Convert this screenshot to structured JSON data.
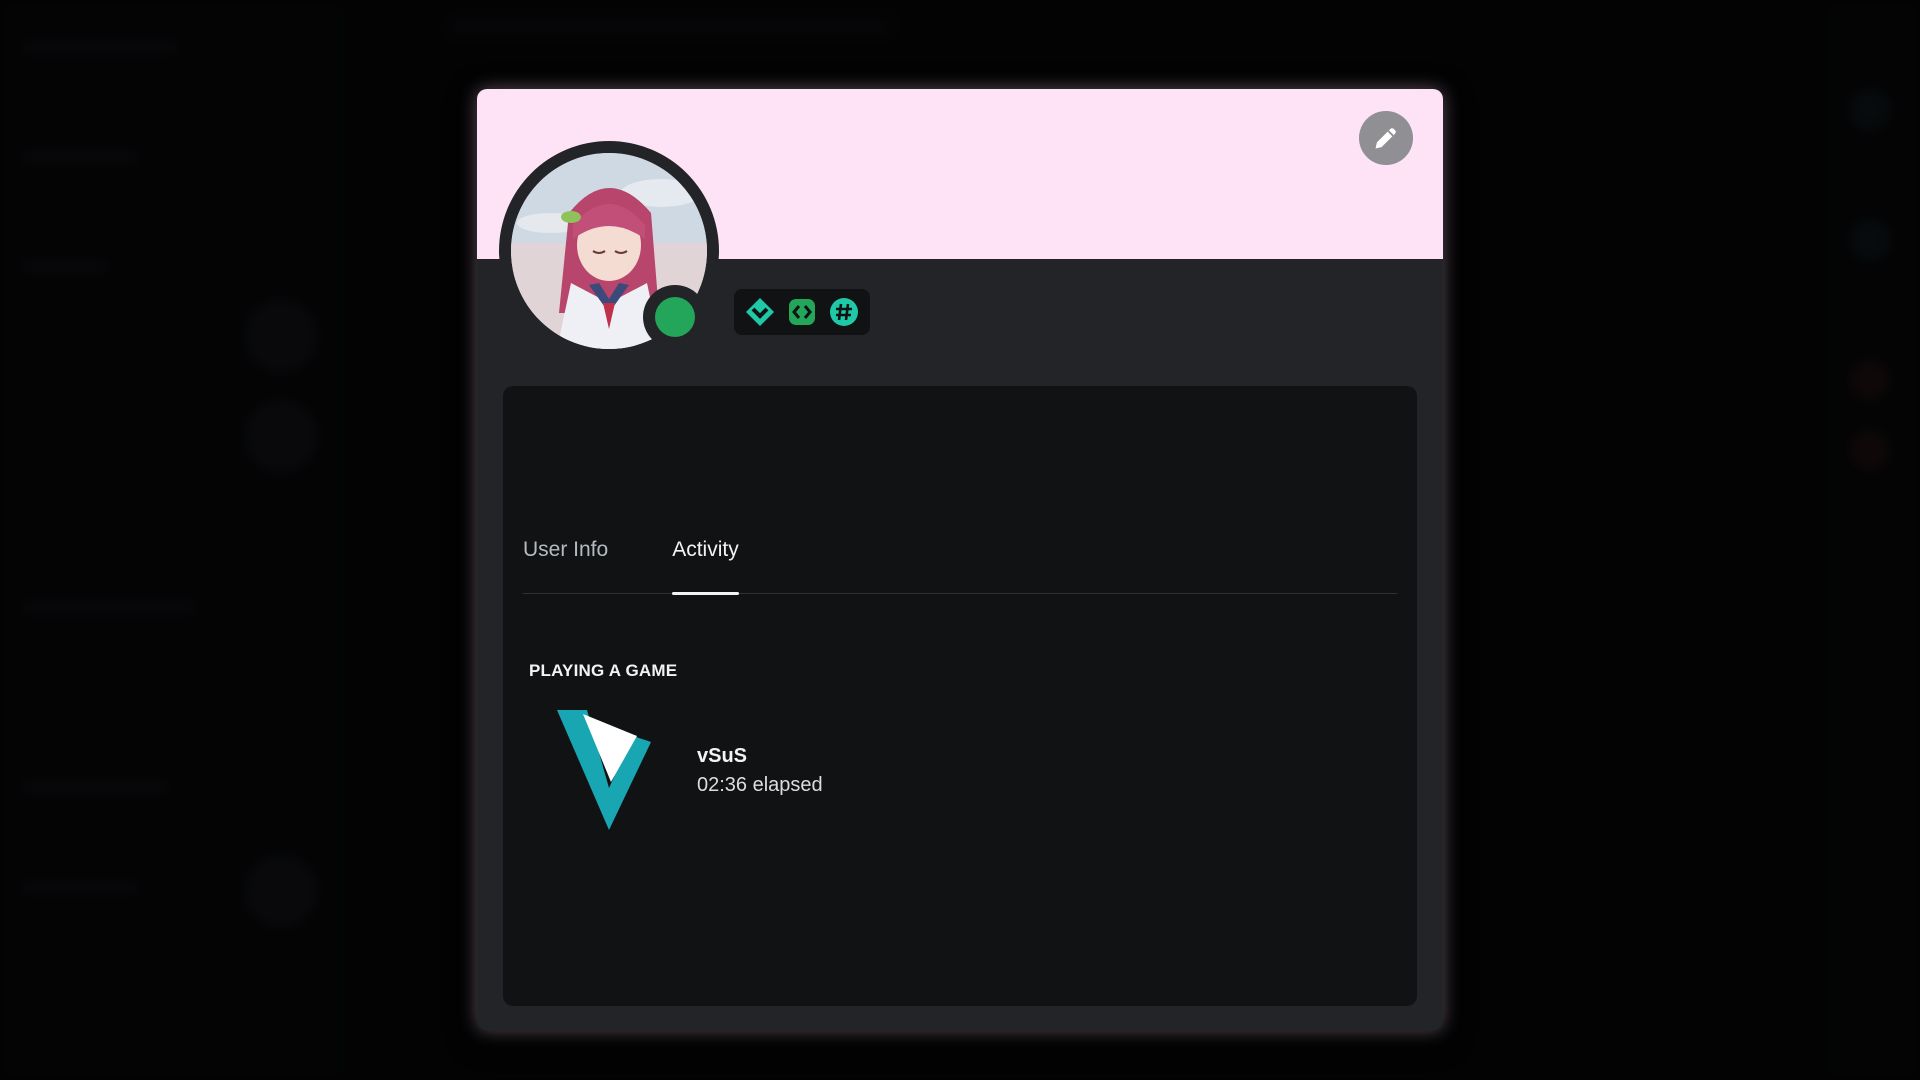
{
  "profile": {
    "banner_color": "#fee3f6",
    "status": "online",
    "status_color": "#23a55a",
    "edit_icon": "pencil-icon",
    "badges": [
      {
        "icon": "hypesquad-balance-icon",
        "color": "#1fc8a6"
      },
      {
        "icon": "active-developer-icon",
        "color": "#23a55a"
      },
      {
        "icon": "hashtag-icon",
        "color": "#1fc8a6"
      }
    ]
  },
  "tabs": [
    {
      "label": "User Info",
      "active": false
    },
    {
      "label": "Activity",
      "active": true
    }
  ],
  "activity": {
    "section_title": "PLAYING A GAME",
    "game": {
      "name": "vSuS",
      "elapsed": "02:36 elapsed",
      "icon": "vsus-logo-icon"
    }
  }
}
